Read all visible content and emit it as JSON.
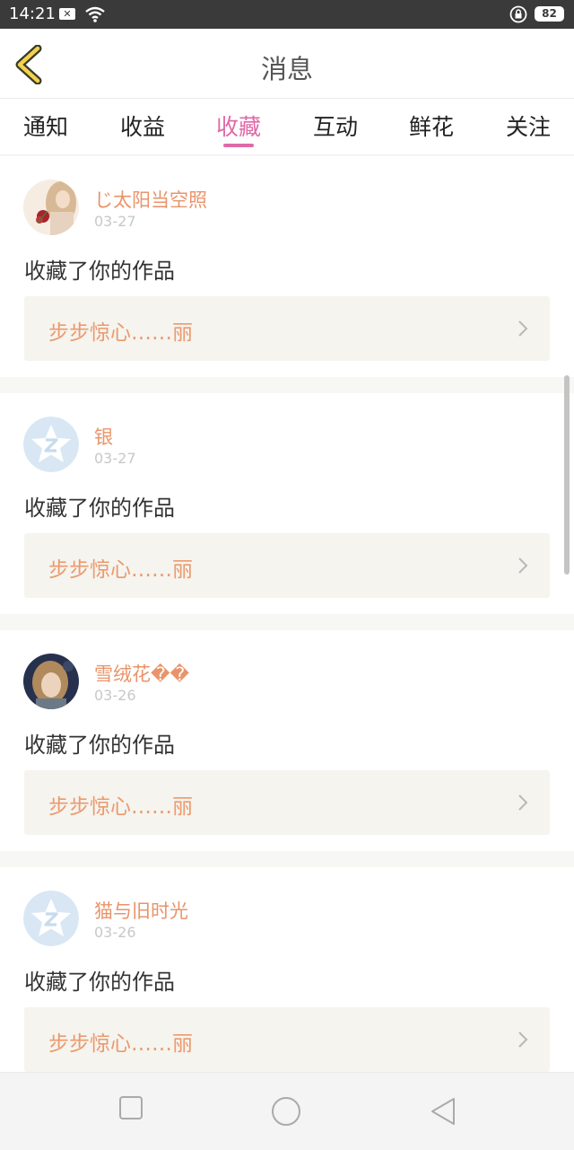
{
  "status_bar": {
    "time": "14:21",
    "battery": "82"
  },
  "header": {
    "title": "消息"
  },
  "tabs": [
    {
      "label": "通知"
    },
    {
      "label": "收益"
    },
    {
      "label": "收藏",
      "active": true
    },
    {
      "label": "互动"
    },
    {
      "label": "鲜花"
    },
    {
      "label": "关注"
    }
  ],
  "colors": {
    "accent": "#e069a7",
    "name": "#e9946a",
    "work_title": "#ec9a6e"
  },
  "feed": [
    {
      "name": "じ太阳当空照",
      "date": "03-27",
      "action": "收藏了你的作品",
      "work_title": "步步惊心……丽",
      "avatar": "photo-girl-rose"
    },
    {
      "name": "银",
      "date": "03-27",
      "action": "收藏了你的作品",
      "work_title": "步步惊心……丽",
      "avatar": "default-star-z"
    },
    {
      "name": "雪绒花��",
      "date": "03-26",
      "action": "收藏了你的作品",
      "work_title": "步步惊心……丽",
      "avatar": "photo-child"
    },
    {
      "name": "猫与旧时光",
      "date": "03-26",
      "action": "收藏了你的作品",
      "work_title": "步步惊心……丽",
      "avatar": "default-star-z"
    }
  ]
}
